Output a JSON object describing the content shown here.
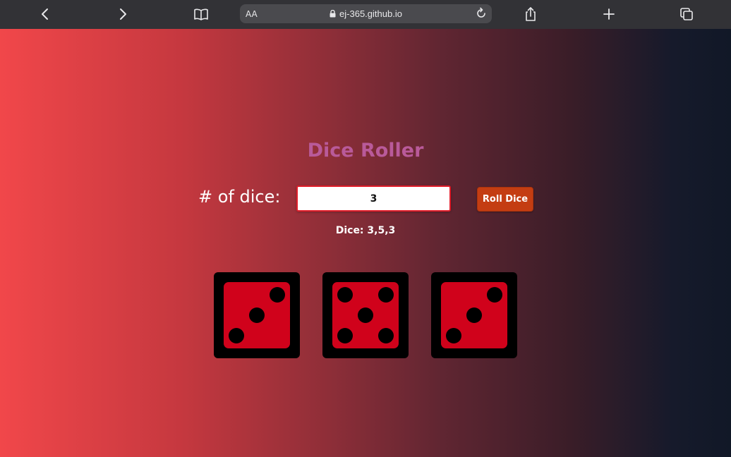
{
  "browser": {
    "text_size_label": "AA",
    "url": "ej-365.github.io",
    "icons": {
      "back": "chevron-left-icon",
      "forward": "chevron-right-icon",
      "reader": "book-icon",
      "lock": "lock-icon",
      "reload": "reload-icon",
      "share": "share-icon",
      "new_tab": "plus-icon",
      "tabs": "tabs-icon"
    }
  },
  "app": {
    "title": "Dice Roller",
    "dice_count_label": "# of dice:",
    "dice_count_value": "3",
    "roll_button_label": "Roll Dice",
    "result_text": "Dice: 3,5,3",
    "dice_values": [
      3,
      5,
      3
    ]
  },
  "colors": {
    "title": "#b95a9a",
    "button": "#c43d12",
    "die_face": "#d0021b",
    "die_border": "#000000",
    "gradient_start": "#f1474a",
    "gradient_end": "#111827"
  }
}
